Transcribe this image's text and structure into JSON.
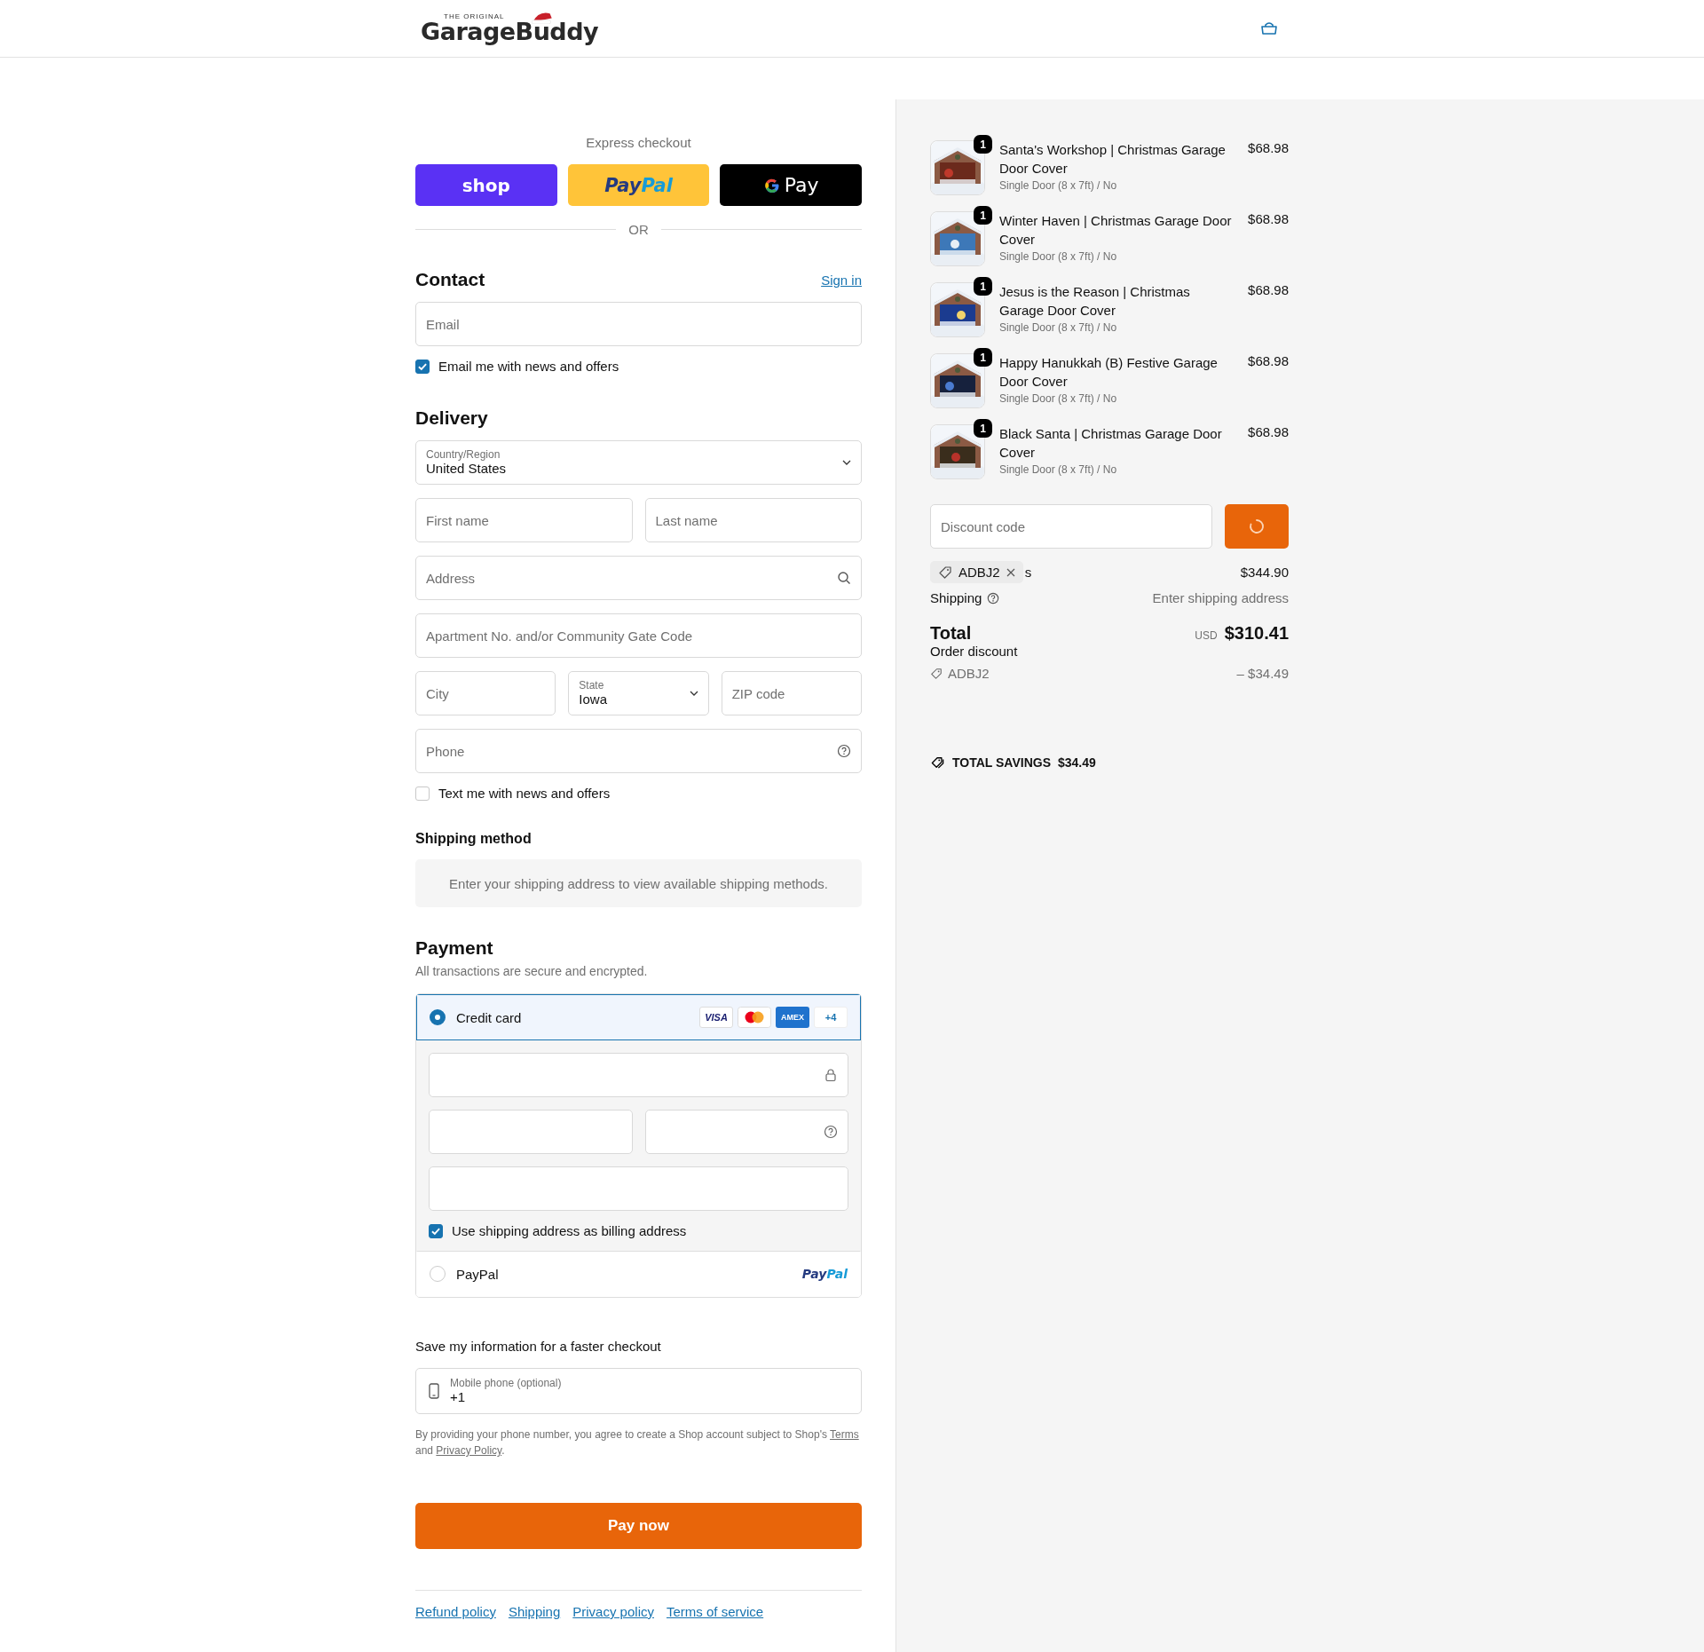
{
  "header": {
    "logo": {
      "tagline": "THE ORIGINAL",
      "name": "GarageBuddy"
    }
  },
  "express": {
    "title": "Express checkout",
    "buttons": [
      {
        "kind": "shop",
        "parts": [
          "shop"
        ]
      },
      {
        "kind": "paypal",
        "parts": [
          "Pay",
          "Pal"
        ]
      },
      {
        "kind": "gpay",
        "parts": [
          "Pay"
        ]
      }
    ],
    "divider": "OR"
  },
  "contact": {
    "heading": "Contact",
    "sign_in": "Sign in",
    "email": {
      "placeholder": "Email"
    },
    "news": {
      "label": "Email me with news and offers",
      "checked": true
    }
  },
  "delivery": {
    "heading": "Delivery",
    "country": {
      "label": "Country/Region",
      "value": "United States"
    },
    "first_name": {
      "placeholder": "First name"
    },
    "last_name": {
      "placeholder": "Last name"
    },
    "address": {
      "placeholder": "Address"
    },
    "apartment": {
      "placeholder": "Apartment No. and/or Community Gate Code"
    },
    "city": {
      "placeholder": "City"
    },
    "state": {
      "label": "State",
      "value": "Iowa"
    },
    "zip": {
      "placeholder": "ZIP code"
    },
    "phone": {
      "placeholder": "Phone"
    },
    "text_news": {
      "label": "Text me with news and offers",
      "checked": false
    }
  },
  "shipping_method": {
    "heading": "Shipping method",
    "notice": "Enter your shipping address to view available shipping methods."
  },
  "payment": {
    "heading": "Payment",
    "subtitle": "All transactions are secure and encrypted.",
    "methods": [
      {
        "kind": "card",
        "label": "Credit card",
        "selected": true,
        "brands": [
          {
            "kind": "visa",
            "label": "VISA"
          },
          {
            "kind": "mastercard"
          },
          {
            "kind": "amex",
            "label": "AMEX"
          },
          {
            "kind": "more",
            "label": "+4"
          }
        ]
      },
      {
        "kind": "paypal",
        "label": "PayPal",
        "selected": false,
        "logo": [
          "Pay",
          "Pal"
        ]
      }
    ],
    "billing_same": {
      "label": "Use shipping address as billing address",
      "checked": true
    }
  },
  "save_info": {
    "heading": "Save my information for a faster checkout",
    "mobile": {
      "label": "Mobile phone (optional)",
      "value": "+1"
    },
    "disclaimer": [
      {
        "kind": "text",
        "text": "By providing your phone number, you agree to create a Shop account subject to Shop's "
      },
      {
        "kind": "link",
        "text": "Terms"
      },
      {
        "kind": "text",
        "text": " and "
      },
      {
        "kind": "link",
        "text": "Privacy Policy"
      },
      {
        "kind": "text",
        "text": "."
      }
    ]
  },
  "pay_button": "Pay now",
  "footer_links": [
    "Refund policy",
    "Shipping",
    "Privacy policy",
    "Terms of service"
  ],
  "order": {
    "items": [
      {
        "name": "Santa's Workshop | Christmas Garage Door Cover",
        "variant": "Single Door (8 x 7ft) / No",
        "price": "$68.98",
        "quantity": "1"
      },
      {
        "name": "Winter Haven | Christmas Garage Door Cover",
        "variant": "Single Door (8 x 7ft) / No",
        "price": "$68.98",
        "quantity": "1"
      },
      {
        "name": "Jesus is the Reason | Christmas Garage Door Cover",
        "variant": "Single Door (8 x 7ft) / No",
        "price": "$68.98",
        "quantity": "1"
      },
      {
        "name": "Happy Hanukkah (B) Festive Garage Door Cover",
        "variant": "Single Door (8 x 7ft) / No",
        "price": "$68.98",
        "quantity": "1"
      },
      {
        "name": "Black Santa | Christmas Garage Door Cover",
        "variant": "Single Door (8 x 7ft) / No",
        "price": "$68.98",
        "quantity": "1"
      }
    ],
    "discount": {
      "placeholder": "Discount code",
      "loading": true
    },
    "applied_code": "ADBJ2",
    "subtotal_label": "s",
    "subtotal": "$344.90",
    "shipping_label": "Shipping",
    "shipping_value": "Enter shipping address",
    "total_label": "Total",
    "currency": "USD",
    "total": "$310.41",
    "order_discount_label": "Order discount",
    "discount_code": "ADBJ2",
    "discount_amount": "– $34.49",
    "savings_label": "TOTAL SAVINGS",
    "savings_amount": "$34.49"
  }
}
